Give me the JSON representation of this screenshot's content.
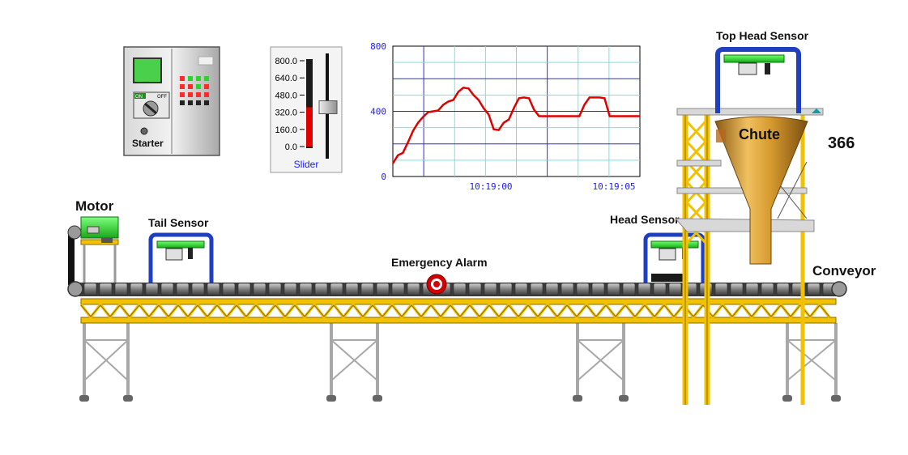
{
  "labels": {
    "motor": "Motor",
    "tail_sensor": "Tail Sensor",
    "emergency_alarm": "Emergency Alarm",
    "head_sensor": "Head Sensor",
    "top_head_sensor": "Top Head Sensor",
    "chute": "Chute",
    "conveyor": "Conveyor",
    "starter": "Starter",
    "slider": "Slider",
    "switch_on": "ON",
    "switch_off": "OFF"
  },
  "readout": {
    "value": "366"
  },
  "slider": {
    "ticks": [
      "800.0",
      "640.0",
      "480.0",
      "320.0",
      "160.0",
      "0.0"
    ],
    "min": 0,
    "max": 800,
    "value": 366
  },
  "colors": {
    "frame_yellow": "#f2c200",
    "frame_dark": "#8a6a00",
    "sensor_blue": "#1f3fbf",
    "sensor_green": "#27d627",
    "trend_red": "#e00000",
    "grid_cyan": "#6fe3e3",
    "grid_blue": "#2b2bd6",
    "chute_gold": "#d69a2e"
  },
  "chart_data": {
    "type": "line",
    "ylim": [
      0,
      800
    ],
    "yticks": [
      "800",
      "400",
      "0"
    ],
    "xticks": [
      "10:19:00",
      "10:19:05"
    ],
    "series": [
      {
        "values": [
          80,
          130,
          145,
          210,
          280,
          330,
          365,
          395,
          400,
          405,
          440,
          460,
          470,
          520,
          545,
          540,
          500,
          470,
          420,
          380,
          290,
          285,
          330,
          350,
          420,
          480,
          485,
          480,
          410,
          370,
          370,
          370,
          370,
          370,
          370,
          370,
          370,
          370,
          440,
          485,
          485,
          485,
          480,
          370,
          370,
          370,
          370,
          370,
          370,
          370
        ]
      }
    ]
  }
}
